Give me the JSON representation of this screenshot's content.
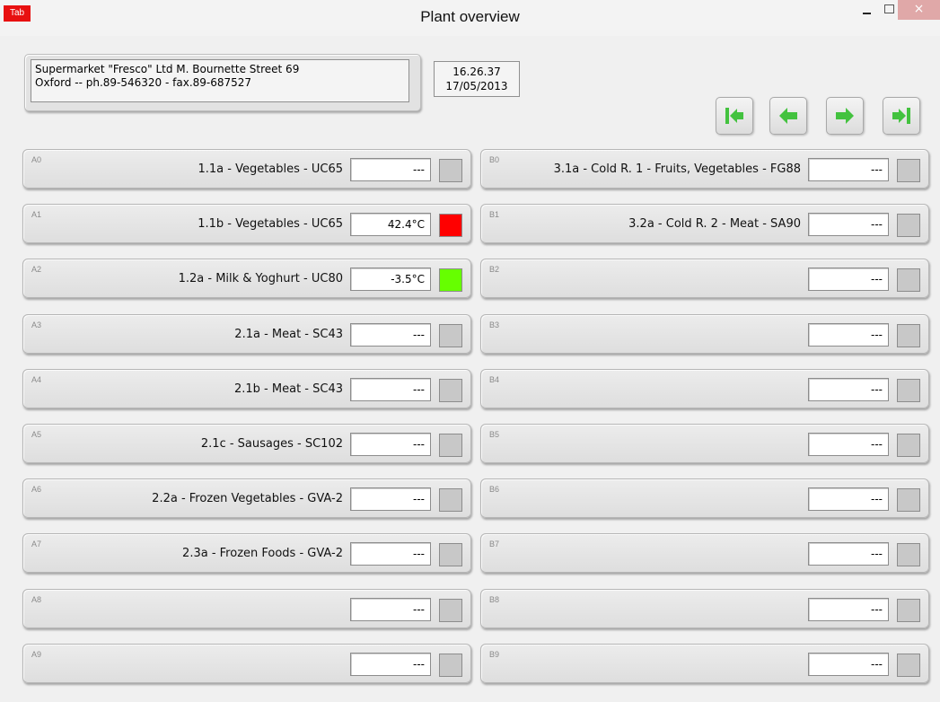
{
  "window": {
    "app_icon_text": "Tab",
    "title": "Plant overview",
    "close_glyph": "×"
  },
  "header": {
    "address_line1": "Supermarket \"Fresco\" Ltd  M. Bournette Street 69",
    "address_line2": "Oxford  --  ph.89-546320 - fax.89-687527",
    "time": "16.26.37",
    "date": "17/05/2013"
  },
  "nav": {
    "icons": [
      "first-icon",
      "previous-icon",
      "next-icon",
      "last-icon"
    ],
    "icon_color": "#43c23f"
  },
  "colors": {
    "led_off": "#c8c8c8",
    "led_red": "#ff0000",
    "led_green": "#66ff00"
  },
  "left_rows": [
    {
      "code": "A0",
      "label": "1.1a - Vegetables - UC65",
      "value": "---",
      "led": "off"
    },
    {
      "code": "A1",
      "label": "1.1b - Vegetables - UC65",
      "value": "42.4°C",
      "led": "red"
    },
    {
      "code": "A2",
      "label": "1.2a - Milk & Yoghurt - UC80",
      "value": "-3.5°C",
      "led": "green"
    },
    {
      "code": "A3",
      "label": "2.1a - Meat - SC43",
      "value": "---",
      "led": "off"
    },
    {
      "code": "A4",
      "label": "2.1b - Meat - SC43",
      "value": "---",
      "led": "off"
    },
    {
      "code": "A5",
      "label": "2.1c - Sausages - SC102",
      "value": "---",
      "led": "off"
    },
    {
      "code": "A6",
      "label": "2.2a - Frozen Vegetables - GVA-2",
      "value": "---",
      "led": "off"
    },
    {
      "code": "A7",
      "label": "2.3a - Frozen Foods - GVA-2",
      "value": "---",
      "led": "off"
    },
    {
      "code": "A8",
      "label": "",
      "value": "---",
      "led": "off"
    },
    {
      "code": "A9",
      "label": "",
      "value": "---",
      "led": "off"
    }
  ],
  "right_rows": [
    {
      "code": "B0",
      "label": "3.1a - Cold R. 1 - Fruits, Vegetables - FG88",
      "value": "---",
      "led": "off"
    },
    {
      "code": "B1",
      "label": "3.2a - Cold R. 2 - Meat - SA90",
      "value": "---",
      "led": "off"
    },
    {
      "code": "B2",
      "label": "",
      "value": "---",
      "led": "off"
    },
    {
      "code": "B3",
      "label": "",
      "value": "---",
      "led": "off"
    },
    {
      "code": "B4",
      "label": "",
      "value": "---",
      "led": "off"
    },
    {
      "code": "B5",
      "label": "",
      "value": "---",
      "led": "off"
    },
    {
      "code": "B6",
      "label": "",
      "value": "---",
      "led": "off"
    },
    {
      "code": "B7",
      "label": "",
      "value": "---",
      "led": "off"
    },
    {
      "code": "B8",
      "label": "",
      "value": "---",
      "led": "off"
    },
    {
      "code": "B9",
      "label": "",
      "value": "---",
      "led": "off"
    }
  ]
}
